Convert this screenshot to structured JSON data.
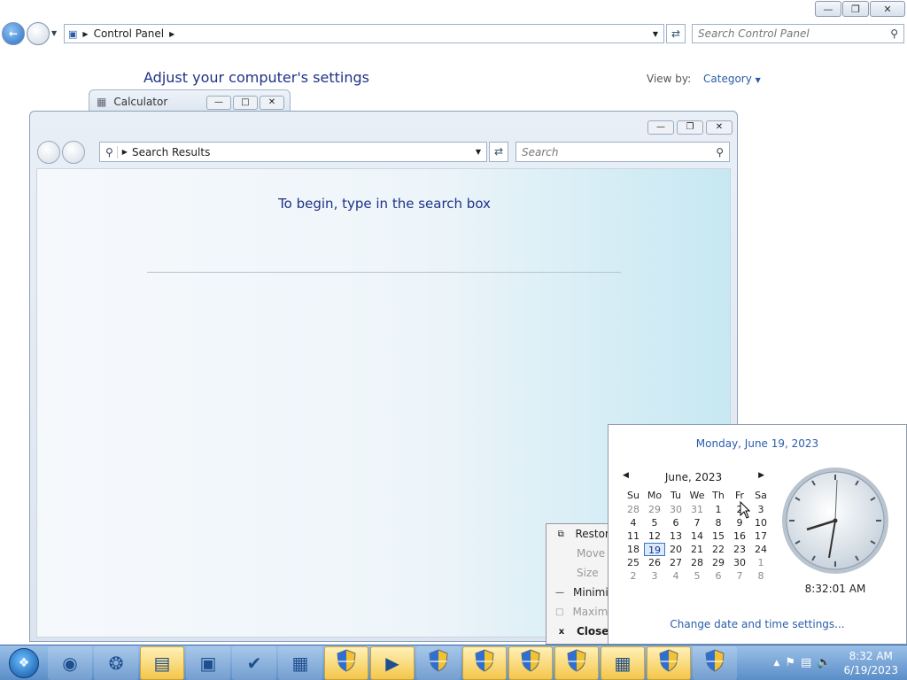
{
  "control_panel": {
    "breadcrumb_root": "Control Panel",
    "search_placeholder": "Search Control Panel",
    "heading": "Adjust your computer's settings",
    "view_by_label": "View by:",
    "view_by_value": "Category"
  },
  "calculator": {
    "title": "Calculator"
  },
  "search_window": {
    "address": "Search Results",
    "search_placeholder": "Search",
    "hint": "To begin, type in the search box"
  },
  "context_menu": {
    "items": [
      {
        "label": "Restore",
        "icon": "restore-icon",
        "enabled": true
      },
      {
        "label": "Move",
        "icon": "",
        "enabled": false
      },
      {
        "label": "Size",
        "icon": "",
        "enabled": false
      },
      {
        "label": "Minimize",
        "icon": "minimize-icon",
        "enabled": true
      },
      {
        "label": "Maximize",
        "icon": "maximize-icon",
        "enabled": false
      },
      {
        "label": "Close",
        "icon": "close-icon",
        "enabled": true,
        "bold": true
      }
    ]
  },
  "calendar": {
    "long_date": "Monday, June 19, 2023",
    "month_label": "June, 2023",
    "day_headers": [
      "Su",
      "Mo",
      "Tu",
      "We",
      "Th",
      "Fr",
      "Sa"
    ],
    "weeks": [
      [
        "28",
        "29",
        "30",
        "31",
        "1",
        "2",
        "3"
      ],
      [
        "4",
        "5",
        "6",
        "7",
        "8",
        "9",
        "10"
      ],
      [
        "11",
        "12",
        "13",
        "14",
        "15",
        "16",
        "17"
      ],
      [
        "18",
        "19",
        "20",
        "21",
        "22",
        "23",
        "24"
      ],
      [
        "25",
        "26",
        "27",
        "28",
        "29",
        "30",
        "1"
      ],
      [
        "2",
        "3",
        "4",
        "5",
        "6",
        "7",
        "8"
      ]
    ],
    "today": "19",
    "time": "8:32:01 AM",
    "change_link": "Change date and time settings..."
  },
  "taskbar": {
    "items": [
      {
        "name": "chrome-icon",
        "active": false
      },
      {
        "name": "firefox-icon",
        "active": false
      },
      {
        "name": "file-explorer-icon",
        "active": true
      },
      {
        "name": "emulator-pc-icon",
        "active": false
      },
      {
        "name": "notepad-check-icon",
        "active": false
      },
      {
        "name": "control-panel-icon",
        "active": false
      },
      {
        "name": "uac-shield-icon",
        "active": true
      },
      {
        "name": "media-player-icon",
        "active": true
      },
      {
        "name": "uac-shield-icon",
        "active": false
      },
      {
        "name": "uac-shield-icon",
        "active": true
      },
      {
        "name": "uac-shield-icon",
        "active": true
      },
      {
        "name": "uac-shield-icon",
        "active": true
      },
      {
        "name": "calculator-icon",
        "active": true
      },
      {
        "name": "uac-shield-icon",
        "active": true
      },
      {
        "name": "uac-shield-icon",
        "active": false
      }
    ],
    "clock_time": "8:32 AM",
    "clock_date": "6/19/2023"
  }
}
